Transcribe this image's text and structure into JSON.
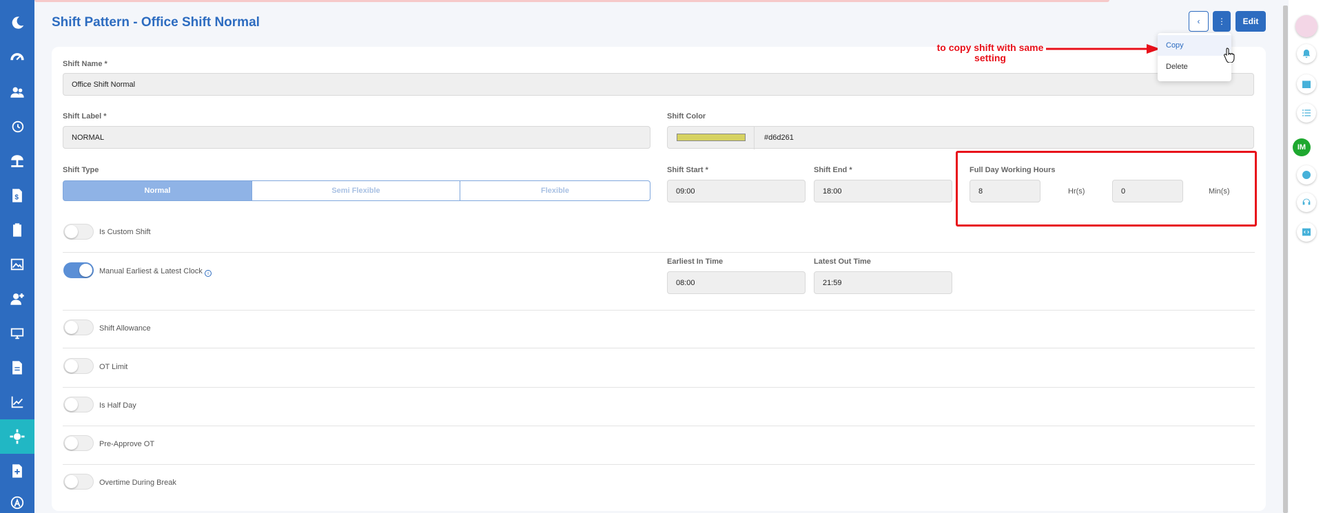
{
  "header": {
    "title": "Shift Pattern - Office Shift Normal",
    "back_label": "‹",
    "more_label": "⋮",
    "edit_label": "Edit"
  },
  "menu": {
    "copy": "Copy",
    "delete": "Delete"
  },
  "annotation": {
    "text": "to copy shift with same setting"
  },
  "form": {
    "shift_name": {
      "label": "Shift Name *",
      "value": "Office Shift Normal"
    },
    "shift_label": {
      "label": "Shift Label *",
      "value": "NORMAL"
    },
    "shift_color": {
      "label": "Shift Color",
      "value": "#d6d261",
      "color": "#d6d261"
    },
    "shift_type": {
      "label": "Shift Type",
      "options": [
        "Normal",
        "Semi Flexible",
        "Flexible"
      ],
      "selected": "Normal"
    },
    "shift_start": {
      "label": "Shift Start *",
      "value": "09:00"
    },
    "shift_end": {
      "label": "Shift End *",
      "value": "18:00"
    },
    "full_day": {
      "label": "Full Day Working Hours",
      "hours": "8",
      "hours_unit": "Hr(s)",
      "minutes": "0",
      "minutes_unit": "Min(s)"
    },
    "earliest_in": {
      "label": "Earliest In Time",
      "value": "08:00"
    },
    "latest_out": {
      "label": "Latest Out Time",
      "value": "21:59"
    },
    "toggles": [
      {
        "label": "Is Custom Shift",
        "on": false
      },
      {
        "label": "Manual Earliest & Latest Clock",
        "on": true
      },
      {
        "label": "Shift Allowance",
        "on": false
      },
      {
        "label": "OT Limit",
        "on": false
      },
      {
        "label": "Is Half Day",
        "on": false
      },
      {
        "label": "Pre-Approve OT",
        "on": false
      },
      {
        "label": "Overtime During Break",
        "on": false
      }
    ],
    "info_glyph": "i"
  },
  "avatar_text": "IM",
  "colors": {
    "brand": "#2d6cc0",
    "sidebar_active": "#21b7c4",
    "highlight": "#e8101a"
  }
}
